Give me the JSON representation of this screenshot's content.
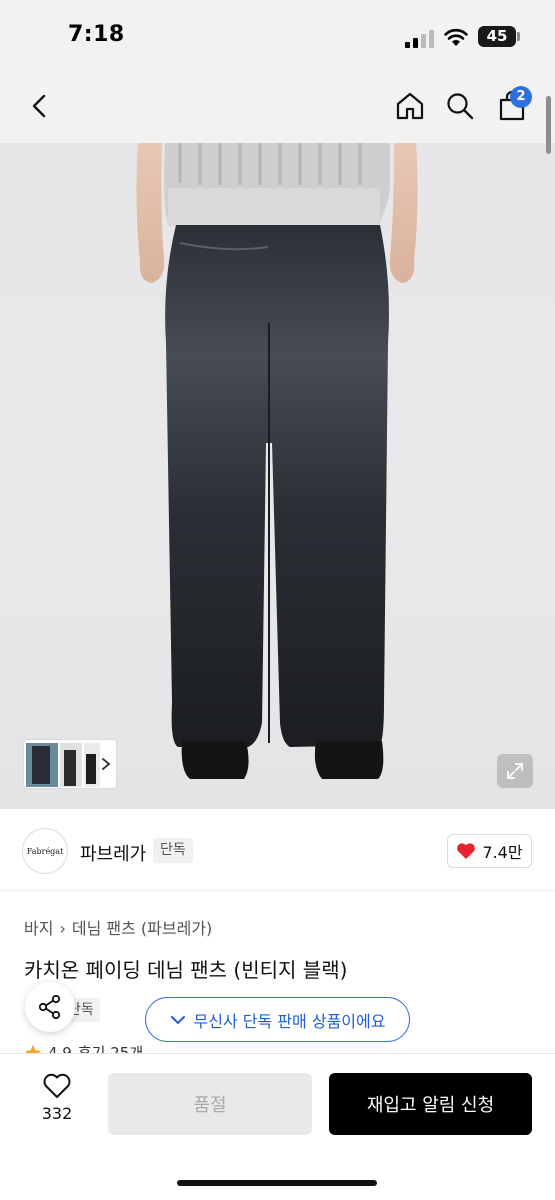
{
  "status_bar": {
    "time": "7:18",
    "battery": "45"
  },
  "nav": {
    "back_icon": "chevron-left-icon",
    "home_icon": "home-icon",
    "search_icon": "search-icon",
    "cart_icon": "shopping-bag-icon",
    "cart_count": "2"
  },
  "gallery": {
    "expand_icon": "expand-icon",
    "thumbnail_next_icon": "chevron-right-icon"
  },
  "brand": {
    "logo_text": "Fabrégat",
    "name": "파브레가",
    "tag": "단독",
    "like_icon": "heart-icon",
    "like_count": "7.4만"
  },
  "product": {
    "breadcrumb": [
      "바지",
      "데님 팬츠 (파브레가)"
    ],
    "title": "카치온 페이딩 데님 팬츠 (빈티지 블랙)",
    "exclusive_tag": "단독",
    "rating": "4.9",
    "review_label": "후기 25개",
    "exclusive_banner": "무신사 단독 판매 상품이에요",
    "share_icon": "share-icon"
  },
  "actions": {
    "wish_count": "332",
    "soldout_label": "품절",
    "restock_label": "재입고 알림 신청"
  },
  "colors": {
    "accent_blue": "#2f6fe0",
    "heart_red": "#e8222f",
    "star_orange": "#f5a623"
  }
}
